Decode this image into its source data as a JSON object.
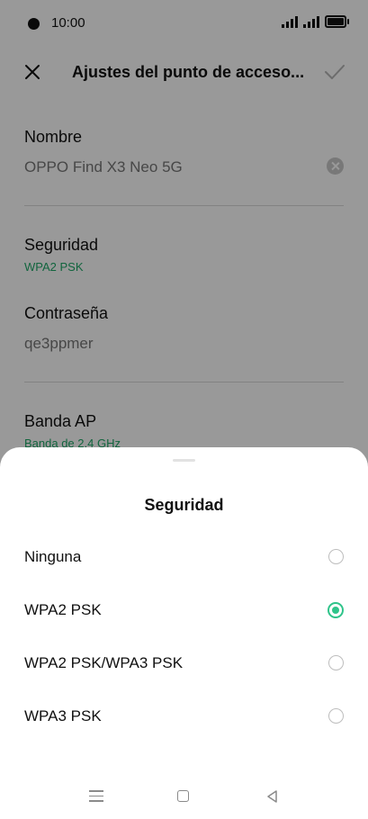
{
  "status": {
    "time": "10:00"
  },
  "appbar": {
    "title": "Ajustes del punto de acceso..."
  },
  "fields": {
    "name": {
      "label": "Nombre",
      "value": "OPPO Find X3 Neo 5G"
    },
    "security": {
      "label": "Seguridad",
      "value": "WPA2 PSK"
    },
    "password": {
      "label": "Contraseña",
      "value": "qe3ppmer"
    },
    "band": {
      "label": "Banda AP",
      "value": "Banda de 2,4 GHz"
    }
  },
  "sheet": {
    "title": "Seguridad",
    "options": [
      {
        "label": "Ninguna",
        "selected": false
      },
      {
        "label": "WPA2 PSK",
        "selected": true
      },
      {
        "label": "WPA2 PSK/WPA3 PSK",
        "selected": false
      },
      {
        "label": "WPA3 PSK",
        "selected": false
      }
    ]
  },
  "colors": {
    "accent": "#2fc48a",
    "green_text": "#1ea868",
    "scrim": "rgba(0,0,0,0.40)"
  },
  "icons": [
    "close-icon",
    "check-icon",
    "clear-text-icon",
    "radio-icon",
    "menu-icon",
    "home-icon",
    "back-icon"
  ]
}
